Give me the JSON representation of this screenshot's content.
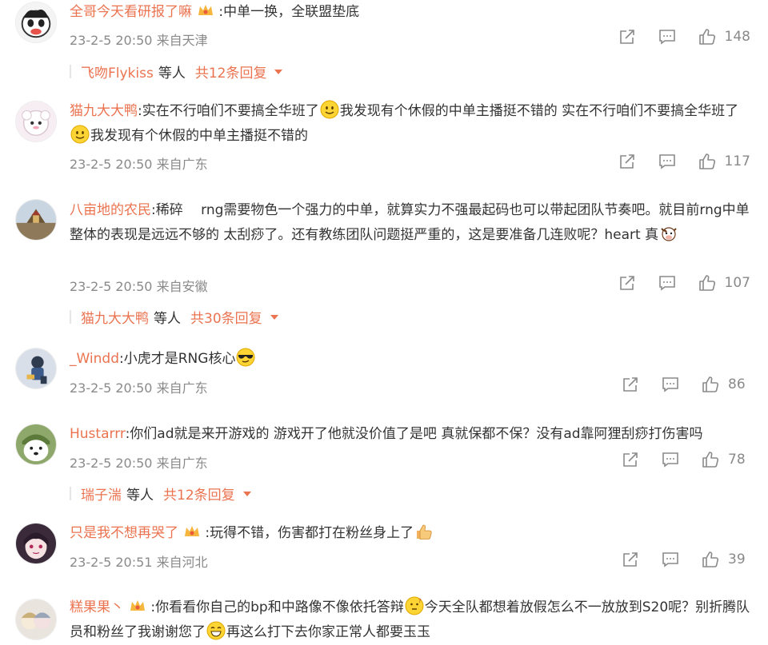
{
  "comments": [
    {
      "user": "全哥今天看研报了嘛",
      "has_badge": true,
      "parts": [
        ":中单一换，全联盟垫底"
      ],
      "time": "23-2-5 20:50",
      "location": "来自天津",
      "likes": "148",
      "avatar_icon": "cartoon-face-avatar",
      "replies": {
        "name": "飞吻Flykiss",
        "others": "等人",
        "count": "共12条回复"
      }
    },
    {
      "user": "猫九大大鸭",
      "has_badge": false,
      "parts": [
        ":实在不行咱们不要搞全华班了",
        "我发现有个休假的中单主播挺不错的 实在不行咱们不要搞全华班了",
        "我发现有个休假的中单主播挺不错的"
      ],
      "time": "23-2-5 20:50",
      "location": "来自广东",
      "likes": "117",
      "avatar_icon": "sheep-avatar"
    },
    {
      "user": "八亩地的农民",
      "has_badge": false,
      "parts": [
        ":稀碎　 rng需要物色一个强力的中单，就算实力不强最起码也可以带起团队节奏吧。就目前rng中单整体的表现是远远不够的 太刮痧了。还有教练团队问题挺严重的，这是要准备几连败呢？heart 真"
      ],
      "time": "23-2-5 20:50",
      "location": "来自安徽",
      "likes": "107",
      "avatar_icon": "mountain-temple-avatar",
      "replies": {
        "name": "猫九大大鸭",
        "others": "等人",
        "count": "共30条回复"
      }
    },
    {
      "user": "_Windd",
      "has_badge": false,
      "parts": [
        ":小虎才是RNG核心"
      ],
      "time": "23-2-5 20:50",
      "location": "来自广东",
      "likes": "86",
      "avatar_icon": "game-character-avatar"
    },
    {
      "user": "Hustarrr",
      "has_badge": false,
      "parts": [
        ":你们ad就是来开游戏的 游戏开了他就没价值了是吧 真就保都不保？没有ad靠阿狸刮痧打伤害吗"
      ],
      "time": "23-2-5 20:50",
      "location": "来自广东",
      "likes": "78",
      "avatar_icon": "dog-avatar",
      "replies": {
        "name": "瑞子湍",
        "others": "等人",
        "count": "共12条回复"
      }
    },
    {
      "user": "只是我不想再哭了",
      "has_badge": true,
      "parts": [
        ":玩得不错，伤害都打在粉丝身上了"
      ],
      "time": "23-2-5 20:51",
      "location": "来自河北",
      "likes": "39",
      "avatar_icon": "anime-girl-avatar"
    },
    {
      "user": "糕果果丶",
      "has_badge": true,
      "parts": [
        ":你看看你自己的bp和中路像不像依托答辩",
        "今天全队都想着放假怎么不一放放到S20呢？别折腾队员和粉丝了我谢谢您了",
        "再这么打下去你家正常人都要玉玉"
      ],
      "avatar_icon": "anime-duo-avatar"
    }
  ]
}
